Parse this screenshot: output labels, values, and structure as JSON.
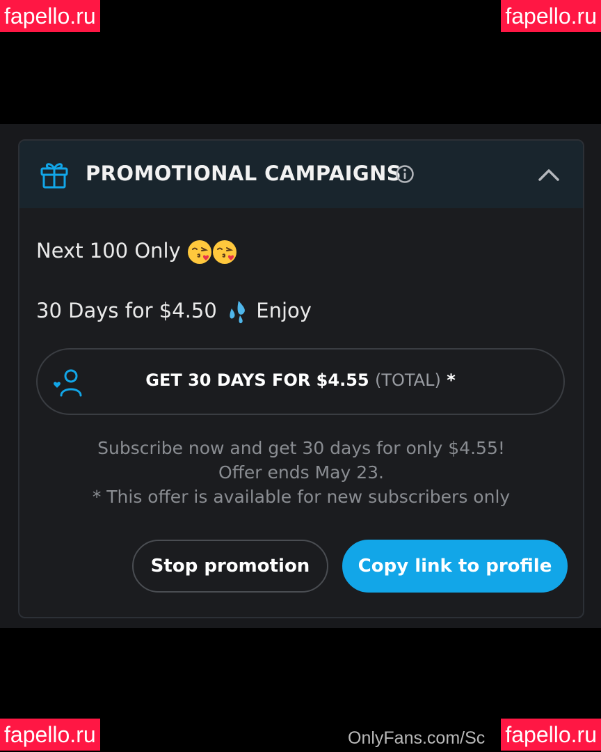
{
  "watermarks": {
    "top_left": "fapello.ru",
    "top_right": "fapello.ru",
    "bottom_left": "fapello.ru",
    "bottom_right": "fapello.ru"
  },
  "card": {
    "title": "PROMOTIONAL CAMPAIGNS",
    "header_icon": "gift-icon",
    "info_icon": "info-icon",
    "collapse_icon": "chevron-up-icon"
  },
  "promo": {
    "line1": "Next 100 Only",
    "line1_emoji": "kissing-face-emoji",
    "line2_prefix": "30 Days for $4.50",
    "line2_emoji": "sweat-droplets-emoji",
    "line2_suffix": "Enjoy"
  },
  "subscribe_button": {
    "icon": "user-heart-icon",
    "main_label": "GET 30 DAYS FOR $4.55",
    "total_label": "(TOTAL)",
    "asterisk": "*"
  },
  "description": {
    "line1": "Subscribe now and get 30 days for only $4.55!",
    "line2": "Offer ends May 23.",
    "line3": "* This offer is available for new subscribers only"
  },
  "actions": {
    "stop_label": "Stop promotion",
    "copy_label": "Copy link to profile"
  },
  "footer": {
    "text": "OnlyFans.com/Sc"
  },
  "colors": {
    "accent": "#12a6e8",
    "watermark": "#ff1744",
    "header_bg": "#19252d",
    "card_bg": "#1b1c1f"
  }
}
